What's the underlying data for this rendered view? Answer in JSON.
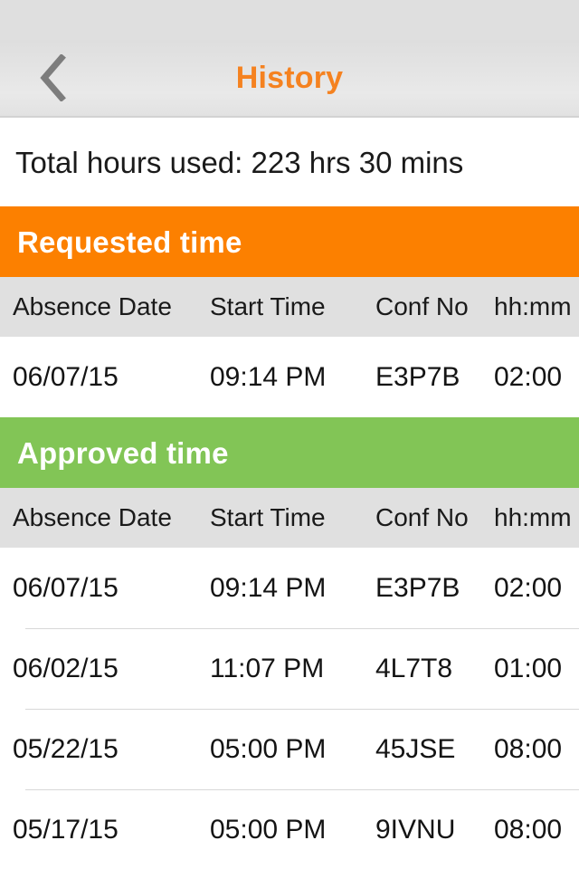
{
  "header": {
    "back_icon": "chevron-left-icon",
    "title": "History"
  },
  "summary": {
    "total_text": "Total hours used: 223 hrs 30 mins"
  },
  "columns": [
    "Absence Date",
    "Start Time",
    "Conf No",
    "hh:mm"
  ],
  "sections": [
    {
      "id": "requested",
      "title": "Requested time",
      "color": "#fc8000",
      "rows": [
        {
          "date": "06/07/15",
          "start": "09:14 PM",
          "conf": "E3P7B",
          "hhmm": "02:00"
        }
      ]
    },
    {
      "id": "approved",
      "title": "Approved time",
      "color": "#82c556",
      "rows": [
        {
          "date": "06/07/15",
          "start": "09:14 PM",
          "conf": "E3P7B",
          "hhmm": "02:00"
        },
        {
          "date": "06/02/15",
          "start": "11:07 PM",
          "conf": "4L7T8",
          "hhmm": "01:00"
        },
        {
          "date": "05/22/15",
          "start": "05:00 PM",
          "conf": "45JSE",
          "hhmm": "08:00"
        },
        {
          "date": "05/17/15",
          "start": "05:00 PM",
          "conf": "9IVNU",
          "hhmm": "08:00"
        }
      ]
    }
  ],
  "theme": {
    "accent_orange": "#f58220",
    "band_orange": "#fc8000",
    "band_green": "#82c556",
    "header_gray": "#e3e3e3",
    "col_head_gray": "#e0e0e0"
  }
}
